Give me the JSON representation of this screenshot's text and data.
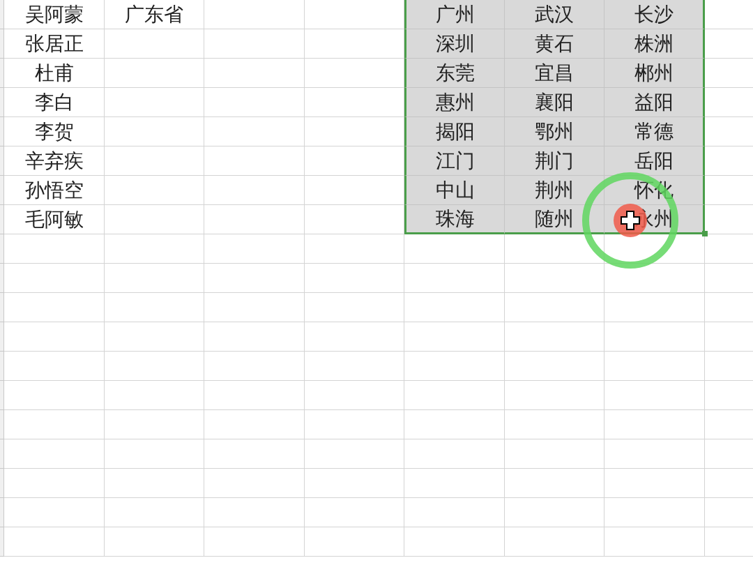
{
  "table": {
    "rows": [
      {
        "column_1": "吴阿蒙",
        "column_2": "广东省",
        "range": [
          {
            "text": "广州",
            "selected": true
          },
          {
            "text": "武汉",
            "selected": true
          },
          {
            "text": "长沙",
            "selected": true
          }
        ]
      },
      {
        "column_1": "张居正",
        "range": [
          {
            "text": "深圳",
            "selected": true
          },
          {
            "text": "黄石",
            "selected": true
          },
          {
            "text": "株洲",
            "selected": true
          }
        ]
      },
      {
        "column_1": "杜甫",
        "range": [
          {
            "text": "东莞",
            "selected": true
          },
          {
            "text": "宜昌",
            "selected": true
          },
          {
            "text": "郴州",
            "selected": true
          }
        ]
      },
      {
        "column_1": "李白",
        "range": [
          {
            "text": "惠州",
            "selected": true
          },
          {
            "text": "襄阳",
            "selected": true
          },
          {
            "text": "益阳",
            "selected": true
          }
        ]
      },
      {
        "column_1": "李贺",
        "range": [
          {
            "text": "揭阳",
            "selected": true
          },
          {
            "text": "鄂州",
            "selected": true
          },
          {
            "text": "常德",
            "selected": true
          }
        ]
      },
      {
        "column_1": "辛弃疾",
        "range": [
          {
            "text": "江门",
            "selected": true
          },
          {
            "text": "荆门",
            "selected": true
          },
          {
            "text": "岳阳",
            "selected": true
          }
        ]
      },
      {
        "column_1": "孙悟空",
        "range": [
          {
            "text": "中山",
            "selected": true
          },
          {
            "text": "荆州",
            "selected": true
          },
          {
            "text": "怀化",
            "selected": true
          }
        ]
      },
      {
        "column_1": "毛阿敏",
        "range": [
          {
            "text": "珠海",
            "selected": true
          },
          {
            "text": "随州",
            "selected": true
          },
          {
            "text": "永州",
            "selected": true
          }
        ]
      }
    ]
  }
}
